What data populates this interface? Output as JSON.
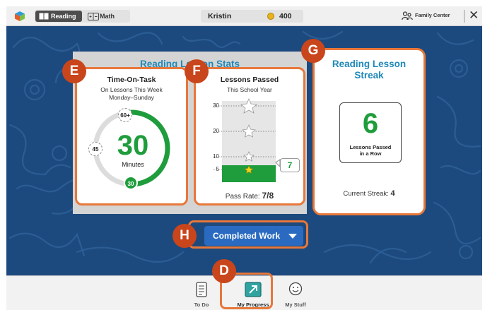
{
  "topbar": {
    "subjects": [
      {
        "label": "Reading",
        "icon": "book-icon",
        "active": true
      },
      {
        "label": "Math",
        "icon": "plus-minus-icon",
        "active": false
      }
    ],
    "user_name": "Kristin",
    "coins": "400",
    "family_center_label": "Family Center",
    "close_icon": "close-icon"
  },
  "stats_section": {
    "title": "Reading Lesson Stats"
  },
  "time_on_task": {
    "badge": "E",
    "title": "Time-On-Task",
    "subtitle_line1": "On Lessons This Week",
    "subtitle_line2": "Monday–Sunday",
    "value": "30",
    "unit": "Minutes",
    "ring_labels": {
      "top": "60+",
      "left": "45",
      "bottom": "30"
    },
    "ring_progress": 0.5,
    "accent_color": "#1f9d3c"
  },
  "lessons_passed": {
    "badge": "F",
    "title": "Lessons Passed",
    "subtitle": "This School Year",
    "ticks": [
      "30",
      "20",
      "10",
      "5"
    ],
    "value": "7",
    "pass_rate_label": "Pass Rate:",
    "pass_rate_value": "7/8"
  },
  "streak": {
    "badge": "G",
    "title_line1": "Reading Lesson",
    "title_line2": "Streak",
    "value": "6",
    "caption_line1": "Lessons Passed",
    "caption_line2": "in a Row",
    "current_label": "Current Streak:",
    "current_value": "4"
  },
  "completed_work": {
    "badge": "H",
    "label": "Completed Work"
  },
  "bottom_nav": {
    "badge": "D",
    "items": [
      {
        "label": "To Do",
        "icon": "checklist-icon"
      },
      {
        "label": "My Progress",
        "icon": "progress-arrow-icon"
      },
      {
        "label": "My Stuff",
        "icon": "smiley-icon"
      }
    ]
  },
  "colors": {
    "brand_blue": "#1d4a7e",
    "highlight_orange": "#e8773a",
    "badge_red": "#c9451b",
    "green": "#1f9d3c",
    "title_teal": "#1e88b8"
  }
}
